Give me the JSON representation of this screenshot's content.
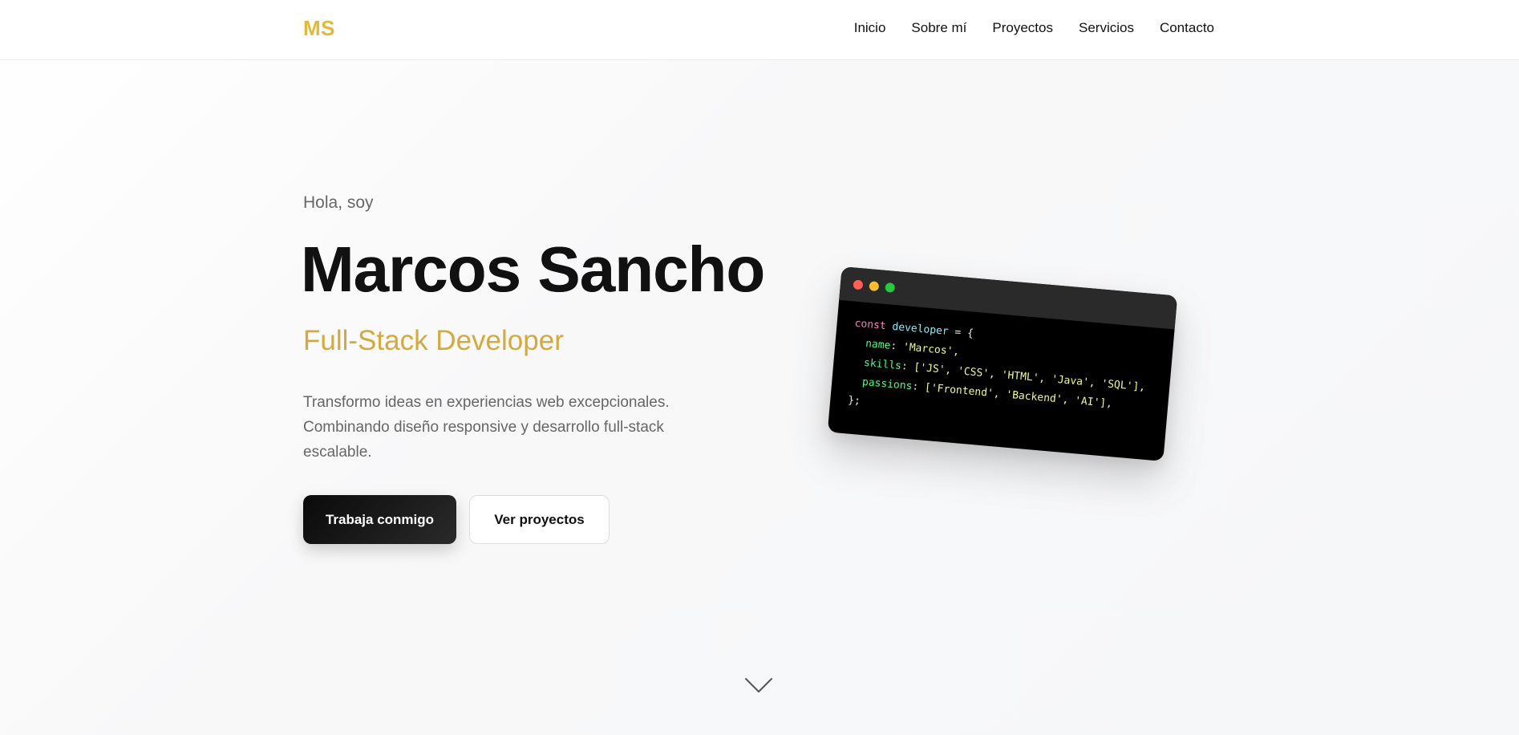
{
  "header": {
    "logo": "MS",
    "nav": [
      "Inicio",
      "Sobre mí",
      "Proyectos",
      "Servicios",
      "Contacto"
    ]
  },
  "hero": {
    "greeting": "Hola, soy",
    "name": "Marcos Sancho",
    "role": "Full-Stack Developer",
    "description": "Transformo ideas en experiencias web excepcionales. Combinando diseño responsive y desarrollo full-stack escalable.",
    "primary_button": "Trabaja conmigo",
    "secondary_button": "Ver proyectos"
  },
  "code_card": {
    "keyword": "const",
    "variable": "developer",
    "open": " = {",
    "lines": [
      {
        "prop": "name",
        "value": "'Marcos',"
      },
      {
        "prop": "skills",
        "value": "['JS', 'CSS', 'HTML', 'Java', 'SQL'],"
      },
      {
        "prop": "passions",
        "value": "['Frontend', 'Backend', 'AI'],"
      }
    ],
    "close": "};"
  },
  "colors": {
    "accent": "#e2b93b",
    "role": "#d4aa3e",
    "dark": "#111111"
  },
  "icons": {
    "scroll": "chevron-down-icon"
  }
}
